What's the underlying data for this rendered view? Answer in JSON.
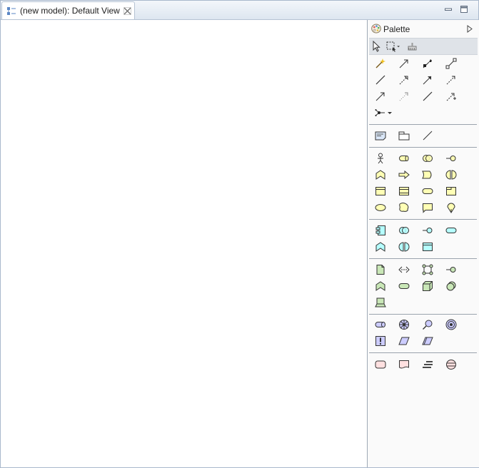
{
  "editor": {
    "tab_title": "(new model): Default View"
  },
  "palette": {
    "title": "Palette"
  },
  "colors": {
    "business": "#ffffb5",
    "application": "#b5ffff",
    "technology": "#c9e7b7",
    "motivation": "#ccccff",
    "implementation": "#ffe0e0"
  },
  "icons": {
    "selection": [
      "select-arrow-icon",
      "marquee-select-icon",
      "format-painter-icon"
    ],
    "relations": [
      "magic-connector-icon",
      "composition-icon",
      "aggregation-icon",
      "assignment-icon",
      "association-icon",
      "realization-icon",
      "serving-icon",
      "access-icon",
      "influence-icon",
      "triggering-icon",
      "flow-icon",
      "specialization-icon",
      "connection-icon",
      "junction-icon"
    ],
    "other": [
      "note-icon",
      "group-icon",
      "line-connection-icon"
    ],
    "business": [
      "business-actor-icon",
      "business-role-icon",
      "business-collaboration-icon",
      "business-interface-icon",
      "business-function-icon",
      "business-process-icon",
      "business-event-icon",
      "business-interaction-icon",
      "business-object-icon",
      "contract-icon",
      "business-service-icon",
      "product-icon",
      "value-icon",
      "representation-icon",
      "meaning-icon",
      "location-icon"
    ],
    "application": [
      "application-component-icon",
      "application-collaboration-icon",
      "application-interface-icon",
      "application-service-icon",
      "application-function-icon",
      "application-interaction-icon",
      "data-object-icon"
    ],
    "technology": [
      "artifact-icon",
      "communication-path-icon",
      "network-icon",
      "infrastructure-interface-icon",
      "infrastructure-function-icon",
      "infrastructure-service-icon",
      "node-icon",
      "system-software-icon",
      "device-icon"
    ],
    "motivation": [
      "stakeholder-icon",
      "driver-icon",
      "assessment-icon",
      "goal-icon",
      "principle-icon",
      "requirement-icon",
      "constraint-icon"
    ],
    "implementation": [
      "work-package-icon",
      "deliverable-icon",
      "gap-icon",
      "plateau-icon"
    ]
  }
}
